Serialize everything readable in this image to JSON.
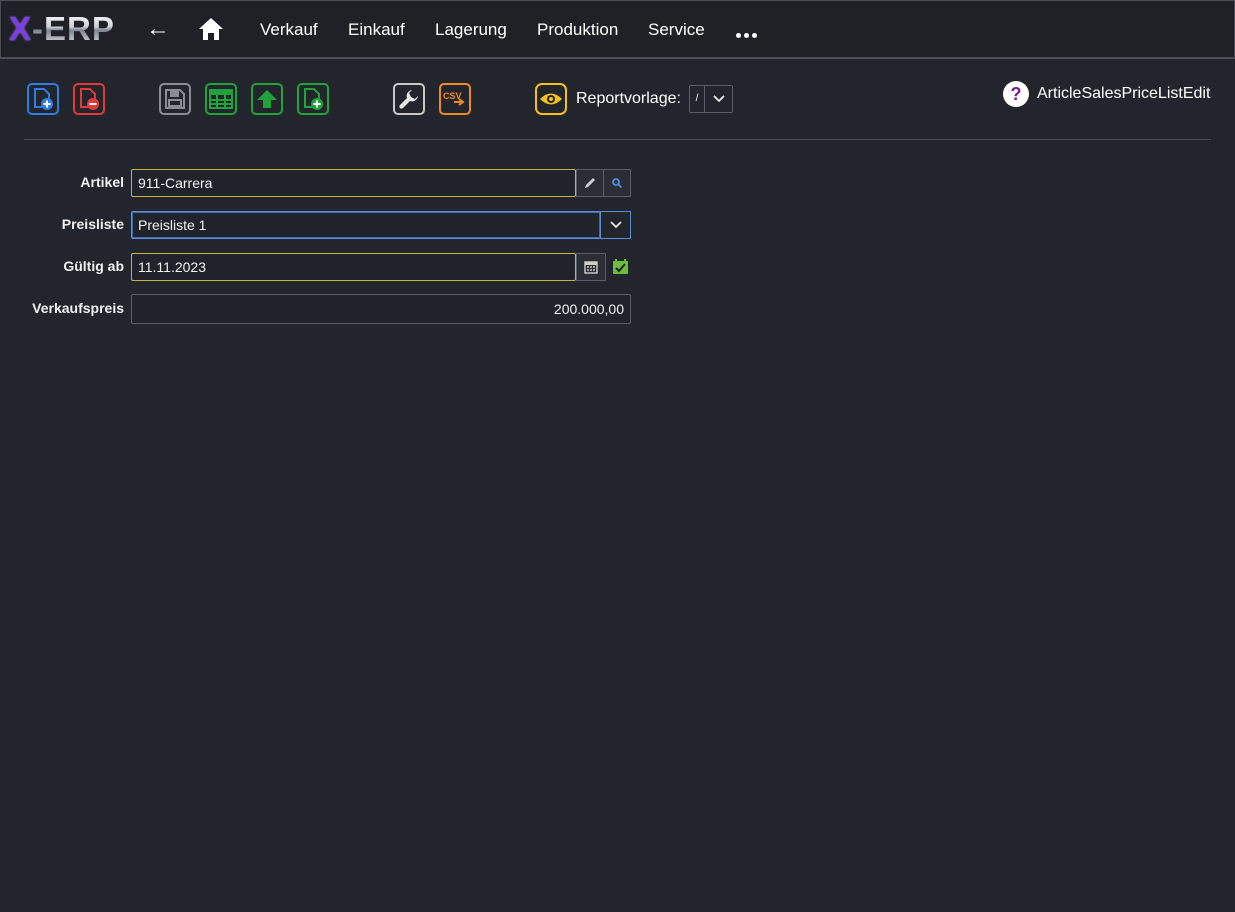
{
  "app": {
    "logo_x": "X",
    "logo_rest": "-ERP",
    "back_glyph": "←"
  },
  "nav": {
    "items": [
      "Verkauf",
      "Einkauf",
      "Lagerung",
      "Produktion",
      "Service"
    ]
  },
  "toolbar": {
    "buttons": [
      {
        "name": "new-document-button",
        "icon": "new-document-icon",
        "color": "#2f7de1"
      },
      {
        "name": "delete-document-button",
        "icon": "delete-document-icon",
        "color": "#e03a3a"
      },
      {
        "name": "save-button",
        "icon": "save-icon",
        "color": "#8a8d93"
      },
      {
        "name": "table-view-button",
        "icon": "table-icon",
        "color": "#1fa33a"
      },
      {
        "name": "upload-button",
        "icon": "upload-arrow-icon",
        "color": "#1fa33a"
      },
      {
        "name": "add-document-button",
        "icon": "add-document-icon",
        "color": "#1fa33a"
      },
      {
        "name": "settings-button",
        "icon": "wrench-icon",
        "color": "#c8c8c8"
      },
      {
        "name": "csv-export-button",
        "icon": "csv-icon",
        "color": "#f08a24"
      },
      {
        "name": "preview-button",
        "icon": "eye-icon",
        "color": "#f2c21b"
      }
    ],
    "csv_text": "CSV",
    "report_label": "Reportvorlage:",
    "report_value": "/"
  },
  "help": {
    "glyph": "?",
    "form_name": "ArticleSalesPriceListEdit"
  },
  "form": {
    "article": {
      "label": "Artikel",
      "value": "911-Carrera"
    },
    "pricelist": {
      "label": "Preisliste",
      "value": "Preisliste 1"
    },
    "valid_from": {
      "label": "Gültig ab",
      "value": "11.11.2023"
    },
    "price": {
      "label": "Verkaufspreis",
      "value": "200.000,00"
    }
  }
}
